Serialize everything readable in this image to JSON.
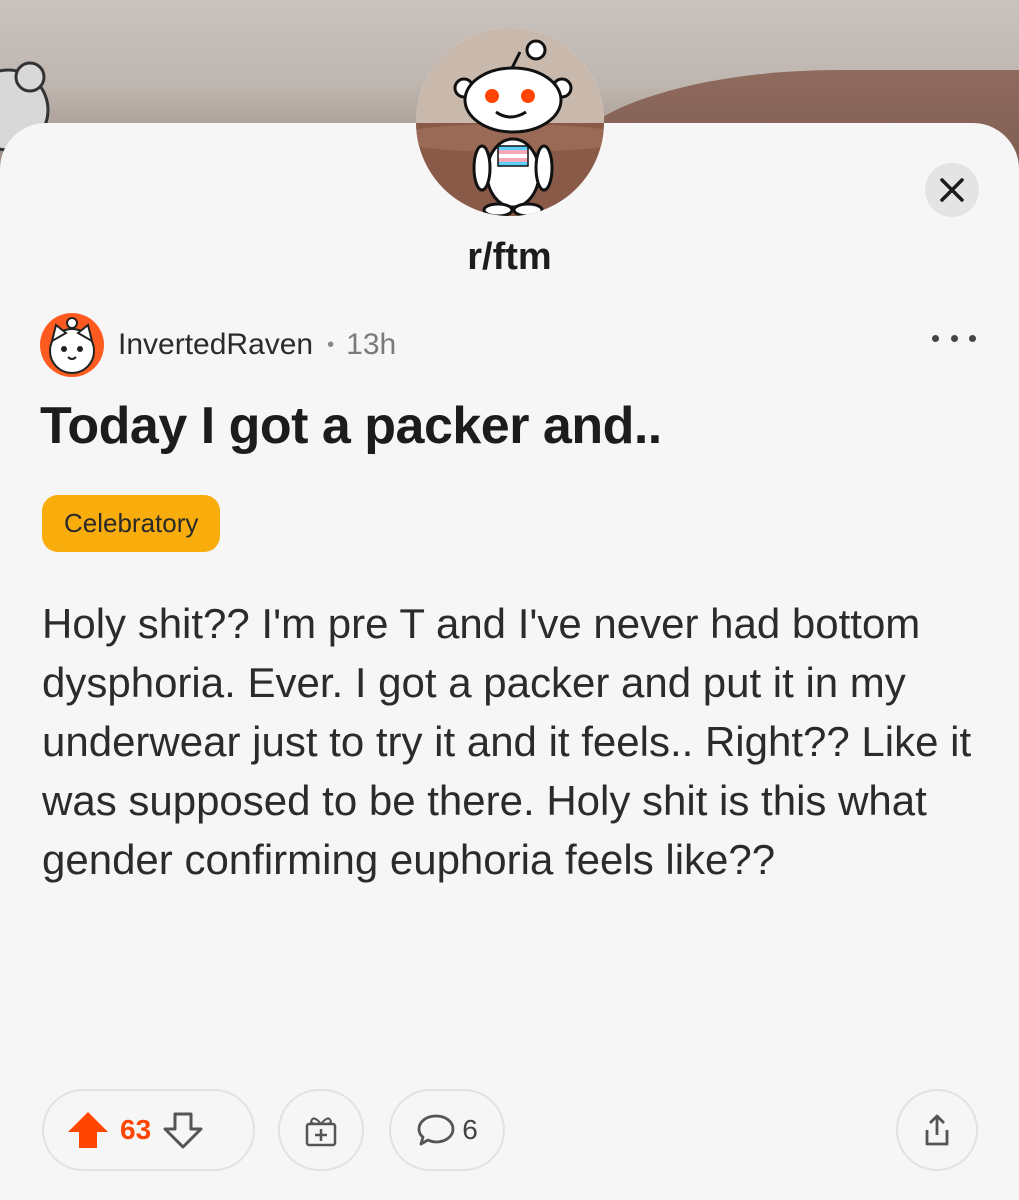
{
  "subreddit": {
    "name": "r/ftm",
    "avatar_icon": "reddit-snoo-trans-flag-icon"
  },
  "post": {
    "author": "InvertedRaven",
    "separator": "•",
    "age": "13h",
    "title": "Today I got a packer and..",
    "flair": "Celebratory",
    "body": "Holy shit?? I'm pre T and I've never had bottom dysphoria. Ever. I got a packer and put it in my underwear just to try it and it feels.. Right?? Like it was supposed to be there. Holy shit is this what gender confirming euphoria feels like??"
  },
  "actions": {
    "votes": "63",
    "comments": "6"
  },
  "colors": {
    "upvote_active": "#ff4500",
    "flair_bg": "#f9ad0d",
    "card_bg": "#f6f6f6"
  },
  "icons": [
    "close-icon",
    "more-options-icon",
    "upvote-icon",
    "downvote-icon",
    "award-icon",
    "comment-icon",
    "share-icon"
  ]
}
